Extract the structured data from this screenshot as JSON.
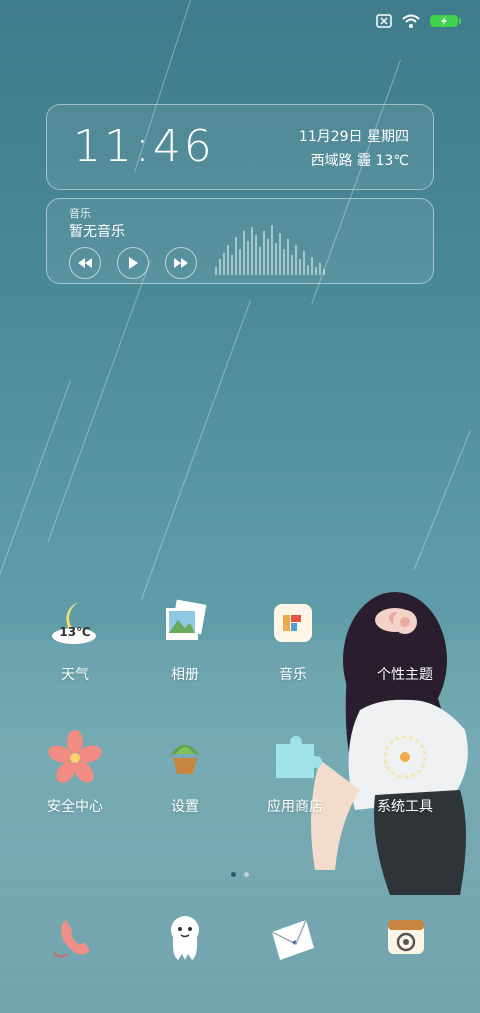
{
  "status_bar": {
    "icons": [
      "sim-absent-icon",
      "wifi-icon",
      "battery-charging-icon"
    ],
    "battery_color": "#3fd24a"
  },
  "clock_widget": {
    "time": "11:46",
    "date": "11月29日  星期四",
    "location_weather": "西域路  霾  13℃"
  },
  "music_widget": {
    "header": "音乐",
    "song": "暂无音乐",
    "controls": [
      "previous-icon",
      "play-icon",
      "next-icon"
    ]
  },
  "weather_icon_temp": "13℃",
  "apps_row1": [
    {
      "label": "天气",
      "icon": "weather-moon-icon"
    },
    {
      "label": "相册",
      "icon": "gallery-photos-icon"
    },
    {
      "label": "音乐",
      "icon": "music-icon"
    },
    {
      "label": "个性主题",
      "icon": "theme-icon"
    }
  ],
  "apps_row2": [
    {
      "label": "安全中心",
      "icon": "flower-security-icon"
    },
    {
      "label": "设置",
      "icon": "plant-settings-icon"
    },
    {
      "label": "应用商店",
      "icon": "puzzle-store-icon"
    },
    {
      "label": "系统工具",
      "icon": "tools-folder-icon"
    }
  ],
  "dock": [
    {
      "icon": "phone-icon"
    },
    {
      "icon": "contacts-ghost-icon"
    },
    {
      "icon": "message-envelope-icon"
    },
    {
      "icon": "camera-icon"
    }
  ],
  "page_indicator": {
    "pages": 2,
    "current": 1
  }
}
